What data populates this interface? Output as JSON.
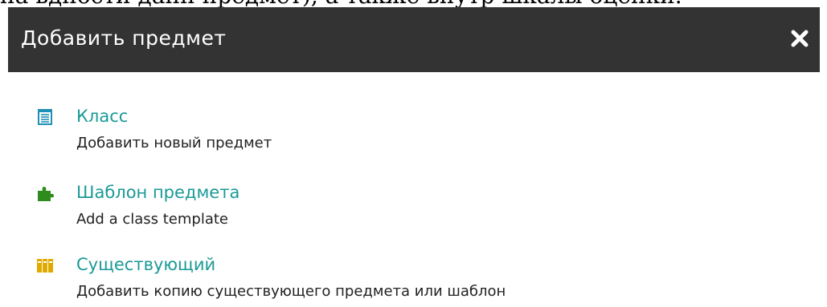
{
  "page_fragment_text": "на вдности данн предмет), а также внутр шкалы оценки.",
  "dialog": {
    "title": "Добавить предмет",
    "close_icon": "close-icon",
    "options": [
      {
        "label": "Класс",
        "description": "Добавить новый предмет",
        "icon": "notebook-icon",
        "icon_color": "#1e8fb5"
      },
      {
        "label": "Шаблон предмета",
        "description": "Add a class template",
        "icon": "puzzle-icon",
        "icon_color": "#2e8b1e"
      },
      {
        "label": "Существующий",
        "description": "Добавить копию существующего предмета или шаблон",
        "icon": "books-icon",
        "icon_color": "#e0a900"
      }
    ]
  },
  "colors": {
    "header_bg": "#333333",
    "link_teal": "#1a9a96",
    "text_dark": "#222222"
  }
}
